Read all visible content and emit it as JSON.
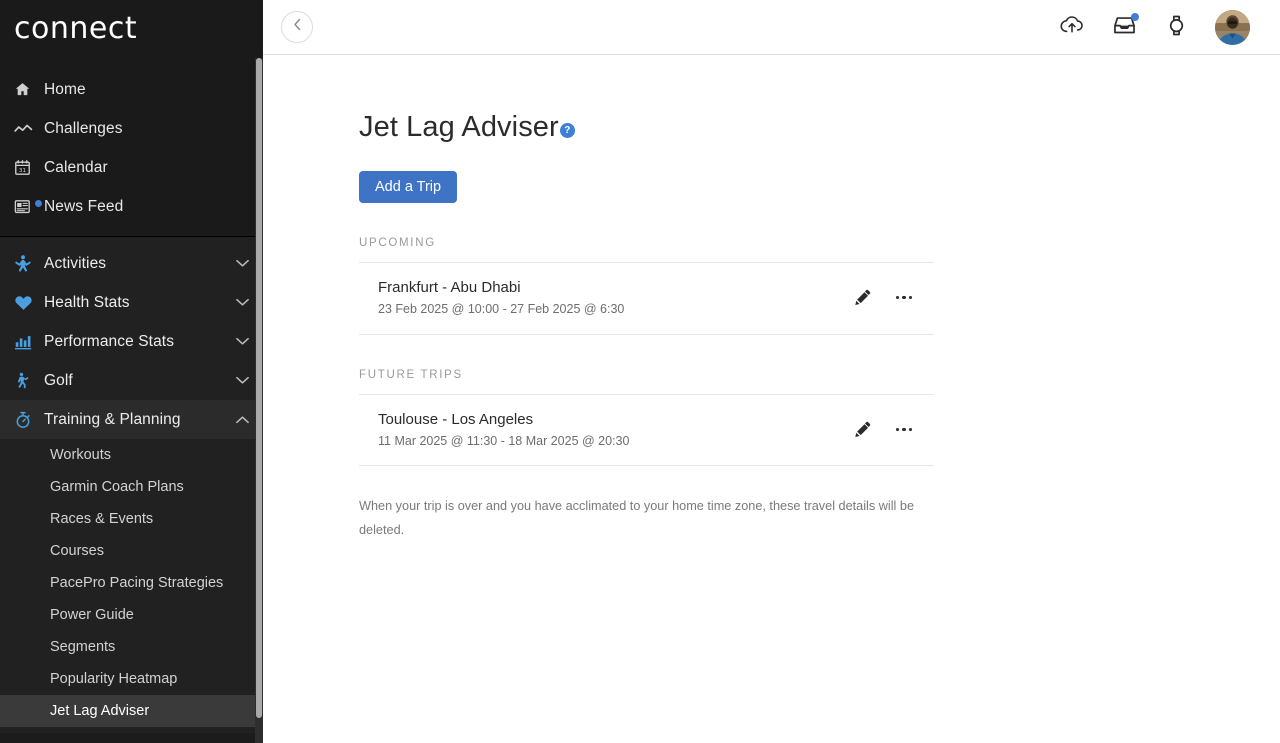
{
  "sidebar": {
    "brand": "connect",
    "top_items": [
      {
        "label": "Home",
        "icon": "home-icon",
        "badge": false
      },
      {
        "label": "Challenges",
        "icon": "challenges-icon",
        "badge": false
      },
      {
        "label": "Calendar",
        "icon": "calendar-icon",
        "badge": false
      },
      {
        "label": "News Feed",
        "icon": "news-feed-icon",
        "badge": true
      }
    ],
    "calendar_day": "31",
    "groups": [
      {
        "label": "Activities",
        "icon": "activities-icon",
        "expanded": false
      },
      {
        "label": "Health Stats",
        "icon": "heart-icon",
        "expanded": false
      },
      {
        "label": "Performance Stats",
        "icon": "bar-chart-icon",
        "expanded": false
      },
      {
        "label": "Golf",
        "icon": "golf-icon",
        "expanded": false
      },
      {
        "label": "Training & Planning",
        "icon": "stopwatch-icon",
        "expanded": true
      }
    ],
    "training_sub_items": [
      {
        "label": "Workouts",
        "active": false
      },
      {
        "label": "Garmin Coach Plans",
        "active": false
      },
      {
        "label": "Races & Events",
        "active": false
      },
      {
        "label": "Courses",
        "active": false
      },
      {
        "label": "PacePro Pacing Strategies",
        "active": false
      },
      {
        "label": "Power Guide",
        "active": false
      },
      {
        "label": "Segments",
        "active": false
      },
      {
        "label": "Popularity Heatmap",
        "active": false
      },
      {
        "label": "Jet Lag Adviser",
        "active": true
      }
    ]
  },
  "topbar": {
    "back_icon": "chevron-left-icon",
    "icons": [
      {
        "name": "cloud-upload-icon",
        "badge": false
      },
      {
        "name": "inbox-icon",
        "badge": true
      },
      {
        "name": "watch-icon",
        "badge": false
      }
    ],
    "avatar_label": "avatar"
  },
  "page": {
    "title": "Jet Lag Adviser",
    "help_icon_label": "?",
    "add_trip_label": "Add a Trip",
    "footnote": "When your trip is over and you have acclimated to your home time zone, these travel details will be deleted."
  },
  "sections": [
    {
      "heading": "UPCOMING",
      "trips": [
        {
          "title": "Frankfurt - Abu Dhabi",
          "dates": "23 Feb 2025 @ 10:00 - 27 Feb 2025 @ 6:30",
          "edit_icon": "pencil-icon",
          "menu_icon": "kebab-menu-icon"
        }
      ]
    },
    {
      "heading": "FUTURE TRIPS",
      "trips": [
        {
          "title": "Toulouse - Los Angeles",
          "dates": "11 Mar 2025 @ 11:30 - 18 Mar 2025 @ 20:30",
          "edit_icon": "pencil-icon",
          "menu_icon": "kebab-menu-icon"
        }
      ]
    }
  ],
  "colors": {
    "accent_blue": "#3f73c6",
    "sidebar_bg": "#1a1a1a",
    "sidebar_bg_alt": "#212121",
    "active_item_bg": "#3a3a3a",
    "icon_blue": "#4a9fe0",
    "badge_blue": "#3f7fd6"
  }
}
